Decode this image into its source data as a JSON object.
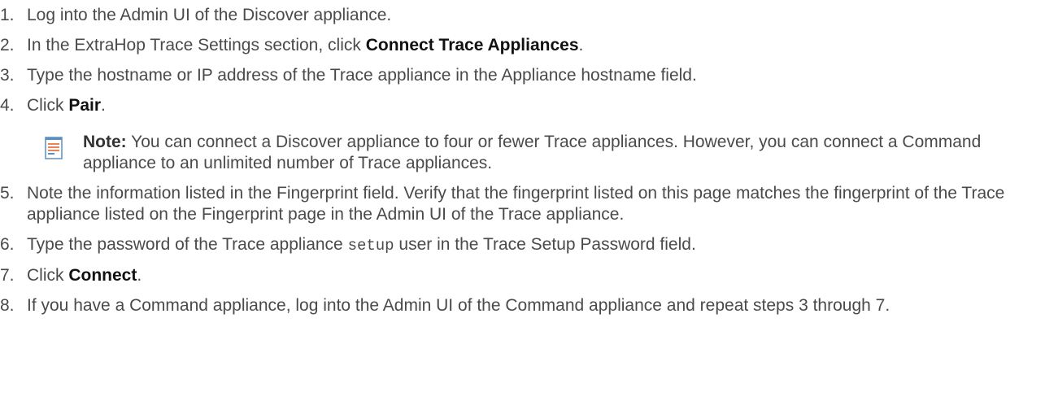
{
  "steps": [
    {
      "num": "1.",
      "parts": [
        {
          "t": "Log into the Admin UI of the Discover appliance."
        }
      ]
    },
    {
      "num": "2.",
      "parts": [
        {
          "t": "In the ExtraHop Trace Settings section, click "
        },
        {
          "t": "Connect Trace Appliances",
          "b": true
        },
        {
          "t": "."
        }
      ]
    },
    {
      "num": "3.",
      "parts": [
        {
          "t": "Type the hostname or IP address of the Trace appliance in the Appliance hostname field."
        }
      ]
    },
    {
      "num": "4.",
      "parts": [
        {
          "t": "Click "
        },
        {
          "t": "Pair",
          "b": true
        },
        {
          "t": "."
        }
      ]
    },
    {
      "num": "5.",
      "parts": [
        {
          "t": "Note the information listed in the Fingerprint field. Verify that the fingerprint listed on this page matches the fingerprint of the Trace appliance listed on the Fingerprint page in the Admin UI of the Trace appliance."
        }
      ]
    },
    {
      "num": "6.",
      "parts": [
        {
          "t": "Type the password of the Trace appliance "
        },
        {
          "t": "setup",
          "m": true
        },
        {
          "t": " user in the Trace Setup Password field."
        }
      ]
    },
    {
      "num": "7.",
      "parts": [
        {
          "t": "Click "
        },
        {
          "t": "Connect",
          "b": true
        },
        {
          "t": "."
        }
      ]
    },
    {
      "num": "8.",
      "parts": [
        {
          "t": "If you have a Command appliance, log into the Admin UI of the Command appliance and repeat steps 3 through 7."
        }
      ]
    }
  ],
  "note": {
    "label": "Note:",
    "text": "You can connect a Discover appliance to four or fewer Trace appliances. However, you can connect a Command appliance to an unlimited number of Trace appliances.",
    "icon": "note-icon"
  },
  "colors": {
    "text": "#4a4a4a",
    "bold": "#111111",
    "icon_orange": "#e8845a",
    "icon_blue": "#5a8fc0"
  }
}
